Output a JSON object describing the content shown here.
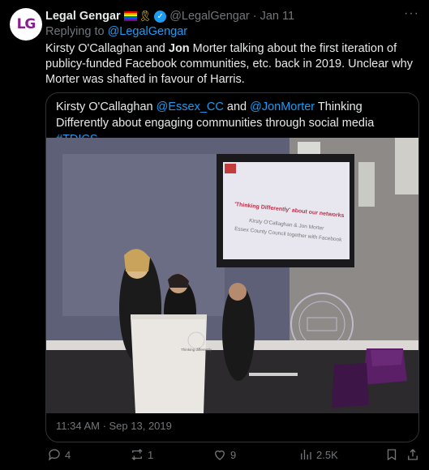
{
  "author": {
    "avatar_text": "LG",
    "name": "Legal Gengar",
    "handle": "@LegalGengar",
    "separator": "·",
    "date": "Jan 11"
  },
  "reply": {
    "prefix": "Replying to",
    "to": "@LegalGengar"
  },
  "tweet": {
    "p1": "Kirsty O'Callaghan and ",
    "bold": "Jon",
    "p2": " Morter talking about the first iteration of publicy-funded Facebook communities, etc. back in 2019. Unclear why Morter was shafted in favour of Harris."
  },
  "quote": {
    "t1": "Kirsty O'Callaghan ",
    "m1": "@Essex_CC",
    "t2": " and ",
    "m2": "@JonMorter",
    "t3": " Thinking Differently about engaging communities through social media ",
    "tag": "#TDICS",
    "timestamp": "11:34 AM · Sep 13, 2019"
  },
  "slide": {
    "title": "'Thinking Differently' about our networks",
    "line1": "Kirsty O'Callaghan & Jon Morter",
    "line2": "Essex County Council together with Facebook",
    "lectern": "Thinking differently"
  },
  "actions": {
    "replies": "4",
    "retweets": "1",
    "likes": "9",
    "views": "2.5K"
  }
}
